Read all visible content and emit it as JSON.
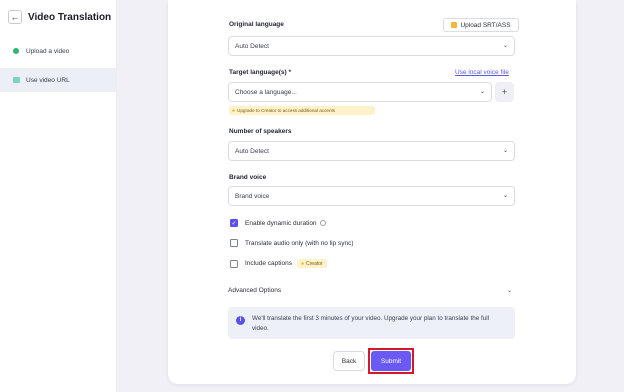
{
  "sidebar": {
    "title": "Video Translation",
    "back_icon": "←",
    "items": [
      {
        "label": "Upload a video",
        "icon": "upload-icon"
      },
      {
        "label": "Use video URL",
        "icon": "link-icon",
        "active": true
      }
    ]
  },
  "form": {
    "original_language": {
      "label": "Original language",
      "value": "Auto Detect",
      "upload_button": "Upload SRT/ASS"
    },
    "target_languages": {
      "label": "Target language(s) *",
      "link": "Use local voice file",
      "placeholder": "Choose a language...",
      "add_button": "+",
      "upgrade_note": "Upgrade to Creator to access additional accents"
    },
    "speakers": {
      "label": "Number of speakers",
      "value": "Auto Detect"
    },
    "brand_voice": {
      "label": "Brand voice",
      "value": "Brand voice"
    },
    "options": [
      {
        "label": "Enable dynamic duration",
        "checked": true
      },
      {
        "label": "Translate audio only (with no lip sync)",
        "checked": false
      },
      {
        "label": "Include captions",
        "checked": false,
        "badge": "Creator"
      }
    ],
    "advanced_options": "Advanced Options",
    "notice": "We'll translate the first 3 minutes of your video. Upgrade your plan to translate the full video.",
    "back_label": "Back",
    "submit_label": "Submit"
  },
  "colors": {
    "accent": "#6a59f2",
    "highlight": "#d4172a"
  }
}
